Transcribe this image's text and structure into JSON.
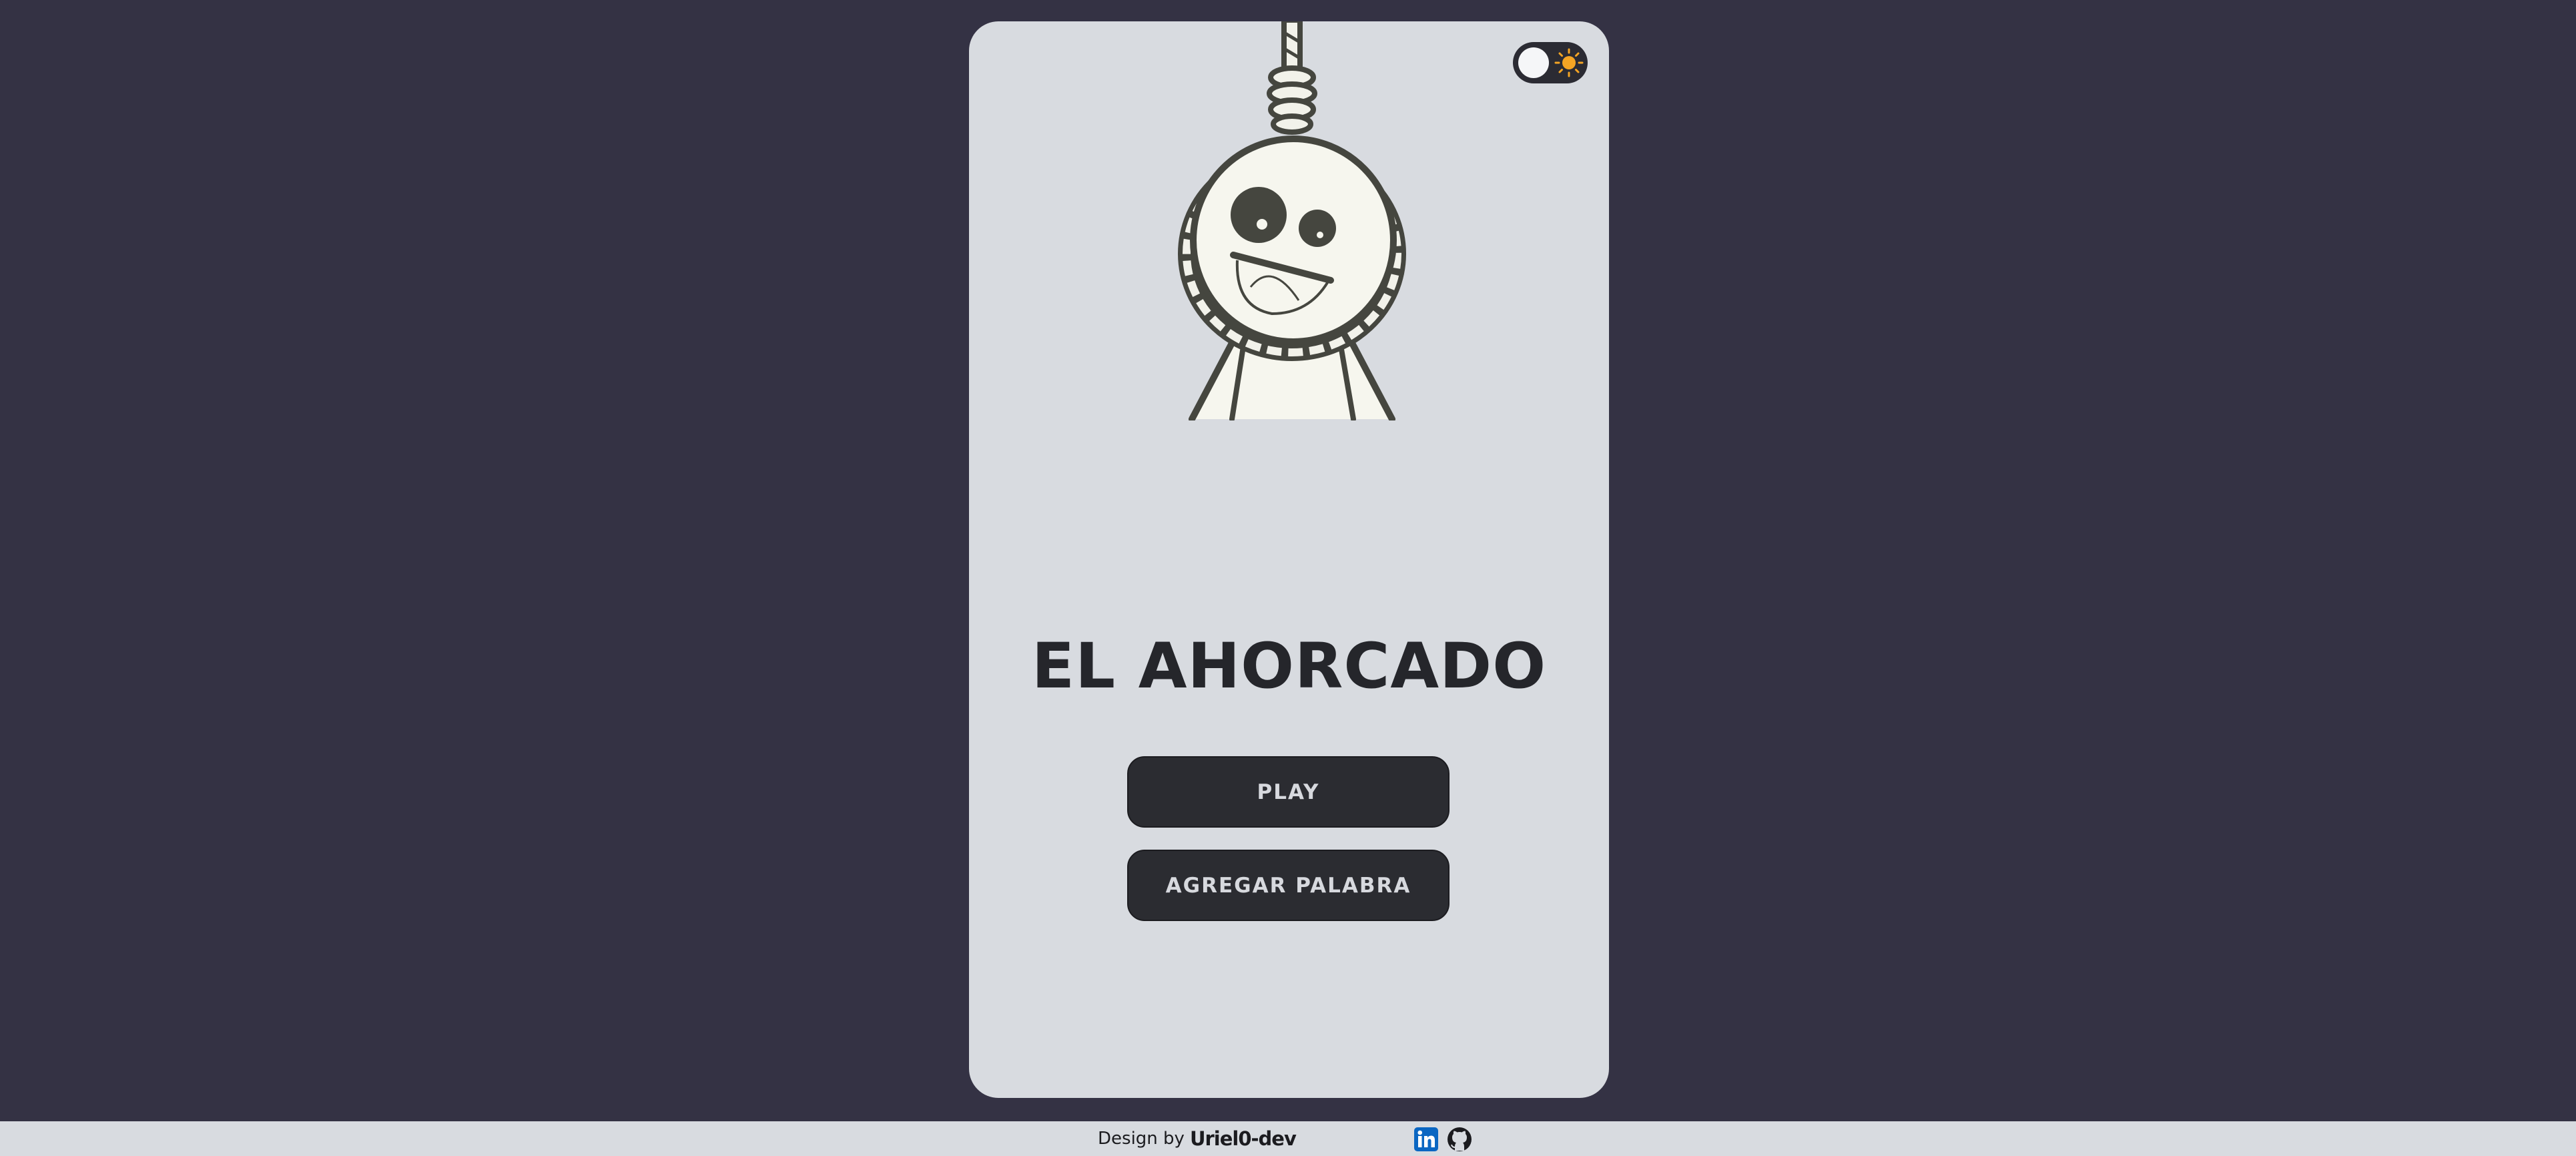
{
  "card": {
    "title": "EL AHORCADO",
    "buttons": {
      "play": "PLAY",
      "add_word": "AGREGAR PALABRA"
    },
    "theme_toggle": {
      "state": "light",
      "icon": "sun-icon"
    }
  },
  "footer": {
    "prefix": "Design by",
    "author": "Uriel0-dev",
    "links": [
      {
        "name": "linkedin",
        "icon": "linkedin-icon"
      },
      {
        "name": "github",
        "icon": "github-icon"
      }
    ]
  },
  "colors": {
    "background": "#343244",
    "card": "#d8dbe0",
    "button": "#2b2c31",
    "button_text": "#d7d9de",
    "title": "#25262b",
    "accent_sun": "#f5a524",
    "linkedin": "#0a66c2"
  }
}
